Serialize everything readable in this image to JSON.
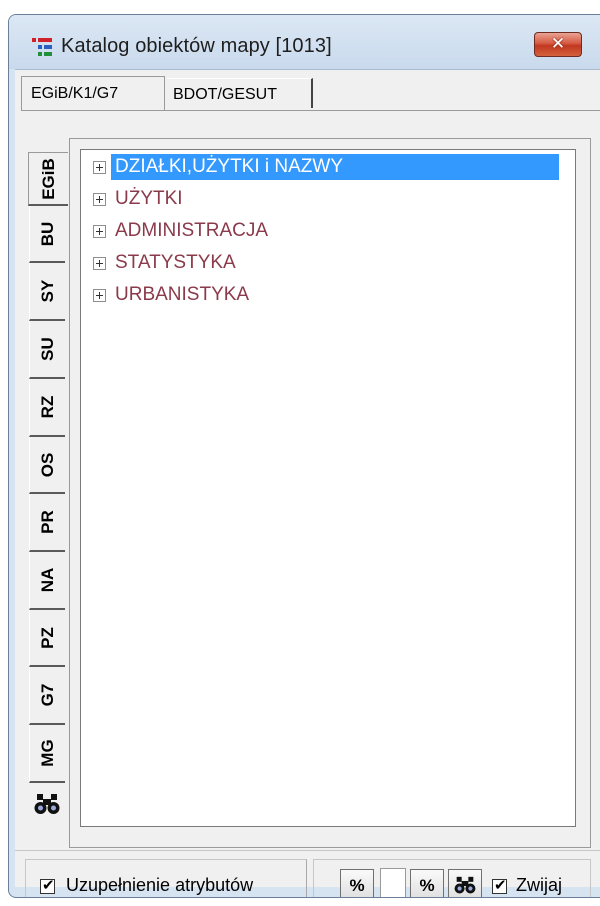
{
  "window": {
    "title": "Katalog obiektów mapy [1013]",
    "close_label": "✕"
  },
  "top_tabs": [
    {
      "label": "EGiB/K1/G7",
      "active": true
    },
    {
      "label": "BDOT/GESUT",
      "active": false
    }
  ],
  "side_tabs": [
    {
      "label": "EGiB",
      "active": true
    },
    {
      "label": "BU"
    },
    {
      "label": "SY"
    },
    {
      "label": "SU"
    },
    {
      "label": "RZ"
    },
    {
      "label": "OS"
    },
    {
      "label": "PR"
    },
    {
      "label": "NA"
    },
    {
      "label": "PZ"
    },
    {
      "label": "G7"
    },
    {
      "label": "MG"
    }
  ],
  "tree": {
    "nodes": [
      {
        "label": "DZIAŁKI,UŻYTKI i NAZWY",
        "selected": true
      },
      {
        "label": "UŻYTKI"
      },
      {
        "label": "ADMINISTRACJA"
      },
      {
        "label": "STATYSTYKA"
      },
      {
        "label": "URBANISTYKA"
      }
    ]
  },
  "bottom": {
    "complete_attributes_label": "Uzupełnienie atrybutów",
    "complete_attributes_checked": true,
    "percent_button_1": "%",
    "percent_button_2": "%",
    "collapse_label": "Zwijaj",
    "collapse_checked": true
  },
  "colors": {
    "selection": "#3399ff",
    "node_text": "#8a3a4a",
    "close_button": "#c1381f"
  }
}
